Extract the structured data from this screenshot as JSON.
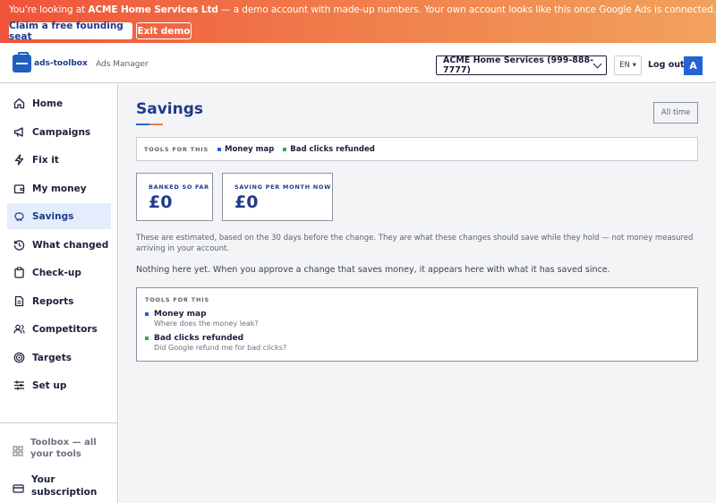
{
  "banner": {
    "prefix": "You're looking at ",
    "account": "ACME Home Services Ltd",
    "suffix": " — a demo account with made-up numbers. Your own account looks like this once Google Ads is connected.",
    "claim_label": "Claim a free founding seat",
    "exit_label": "Exit demo"
  },
  "topbar": {
    "logo_text": "ads-toolbox",
    "section": "Ads Manager",
    "account_selected": "ACME Home Services (999-888-7777)",
    "language": "EN ▾",
    "logout_label": "Log out",
    "avatar_letter": "A"
  },
  "sidebar": {
    "items": [
      {
        "label": "Home",
        "icon": "home-icon"
      },
      {
        "label": "Campaigns",
        "icon": "megaphone-icon"
      },
      {
        "label": "Fix it",
        "icon": "lightning-icon"
      },
      {
        "label": "My money",
        "icon": "wallet-icon"
      },
      {
        "label": "Savings",
        "icon": "piggy-bank-icon"
      },
      {
        "label": "What changed",
        "icon": "history-icon"
      },
      {
        "label": "Check-up",
        "icon": "clipboard-icon"
      },
      {
        "label": "Reports",
        "icon": "document-icon"
      },
      {
        "label": "Competitors",
        "icon": "users-icon"
      },
      {
        "label": "Targets",
        "icon": "target-icon"
      },
      {
        "label": "Set up",
        "icon": "sliders-icon"
      }
    ],
    "active": "Savings",
    "toolbox_line1": "Toolbox — all",
    "toolbox_line2": "your tools",
    "subscription_line1": "Your",
    "subscription_line2": "subscription"
  },
  "main": {
    "title": "Savings",
    "range_button": "All time",
    "tools_caption": "TOOLS FOR THIS",
    "tool_links": [
      "Money map",
      "Bad clicks refunded"
    ],
    "stats": [
      {
        "caption": "BANKED SO FAR",
        "value": "£0"
      },
      {
        "caption": "SAVING PER MONTH NOW",
        "value": "£0"
      }
    ],
    "note": "These are estimated, based on the 30 days before the change. They are what these changes should save while they hold — not money measured arriving in your account.",
    "empty_text": "Nothing here yet. When you approve a change that saves money, it appears here with what it has saved since.",
    "tools_box": {
      "caption": "TOOLS FOR THIS",
      "entries": [
        {
          "name": "Money map",
          "desc": "Where does the money leak?",
          "color": "#2563d6"
        },
        {
          "name": "Bad clicks refunded",
          "desc": "Did Google refund me for bad clicks?",
          "color": "#34a853"
        }
      ]
    }
  },
  "colors": {
    "accent": "#2563d6",
    "brand_navy": "#1e3a8a",
    "banner_start": "#f0523a",
    "banner_end": "#f2a25c",
    "active_nav_bg": "#e4edfb"
  }
}
